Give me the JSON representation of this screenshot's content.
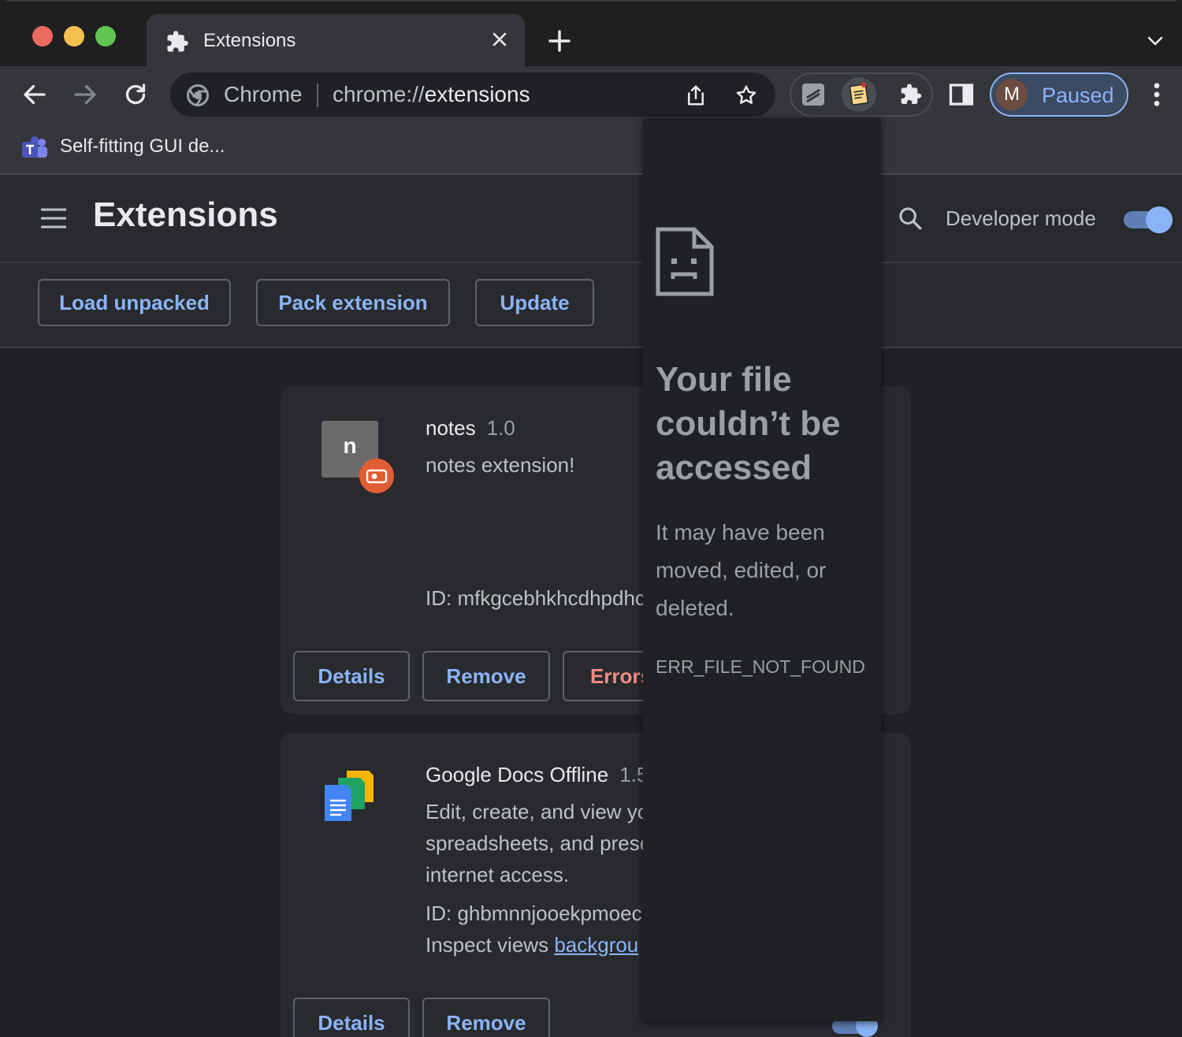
{
  "tab": {
    "title": "Extensions"
  },
  "omnibox": {
    "chip": "Chrome",
    "url_scheme": "chrome://",
    "url_host": "extensions"
  },
  "profile": {
    "avatar_letter": "M",
    "label": "Paused"
  },
  "bookmarks": [
    {
      "label": "Self-fitting GUI de..."
    }
  ],
  "header": {
    "title": "Extensions",
    "dev_mode_label": "Developer mode"
  },
  "devbar": {
    "load_unpacked": "Load unpacked",
    "pack_extension": "Pack extension",
    "update": "Update"
  },
  "extensions": [
    {
      "name": "notes",
      "version": "1.0",
      "description": "notes extension!",
      "icon_letter": "n",
      "id": "ID: mfkgcebhkhcdhpdhc",
      "buttons": {
        "details": "Details",
        "remove": "Remove",
        "errors": "Errors"
      }
    },
    {
      "name": "Google Docs Offline",
      "version": "1.5",
      "description_lines": [
        "Edit, create, and view yo",
        "spreadsheets, and prese",
        "internet access."
      ],
      "id": "ID: ghbmnnjooekpmoec",
      "inspect_label": "Inspect views",
      "inspect_link": "backgrou",
      "buttons": {
        "details": "Details",
        "remove": "Remove"
      }
    }
  ],
  "popup": {
    "title": "Your file couldn’t be accessed",
    "body": "It may have been moved, edited, or deleted.",
    "code": "ERR_FILE_NOT_FOUND"
  },
  "colors": {
    "accent": "#8ab4f8",
    "error": "#f28b82",
    "background": "#202124",
    "surface": "#292a2d"
  }
}
